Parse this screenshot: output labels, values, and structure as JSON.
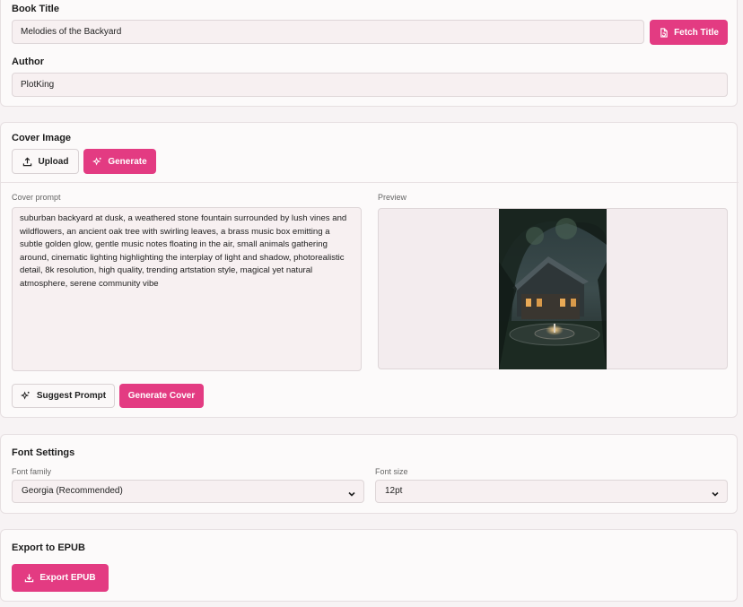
{
  "book": {
    "title_label": "Book Title",
    "title_value": "Melodies of the Backyard",
    "fetch_title_label": "Fetch Title",
    "author_label": "Author",
    "author_value": "PlotKing"
  },
  "cover": {
    "section_title": "Cover Image",
    "upload_label": "Upload",
    "generate_label": "Generate",
    "prompt_label": "Cover prompt",
    "prompt_text": "suburban backyard at dusk, a weathered stone fountain surrounded by lush vines and wildflowers, an ancient oak tree with swirling leaves, a brass music box emitting a subtle golden glow, gentle music notes floating in the air, small animals gathering around, cinematic lighting highlighting the interplay of light and shadow, photorealistic detail, 8k resolution, high quality, trending artstation style, magical yet natural atmosphere, serene community vibe",
    "preview_label": "Preview",
    "suggest_prompt_label": "Suggest Prompt",
    "generate_cover_label": "Generate Cover"
  },
  "font": {
    "section_title": "Font Settings",
    "family_label": "Font family",
    "family_value": "Georgia (Recommended)",
    "size_label": "Font size",
    "size_value": "12pt"
  },
  "export": {
    "section_title": "Export to EPUB",
    "button_label": "Export EPUB"
  },
  "colors": {
    "accent": "#e33b82",
    "background": "#f7f3f4"
  }
}
